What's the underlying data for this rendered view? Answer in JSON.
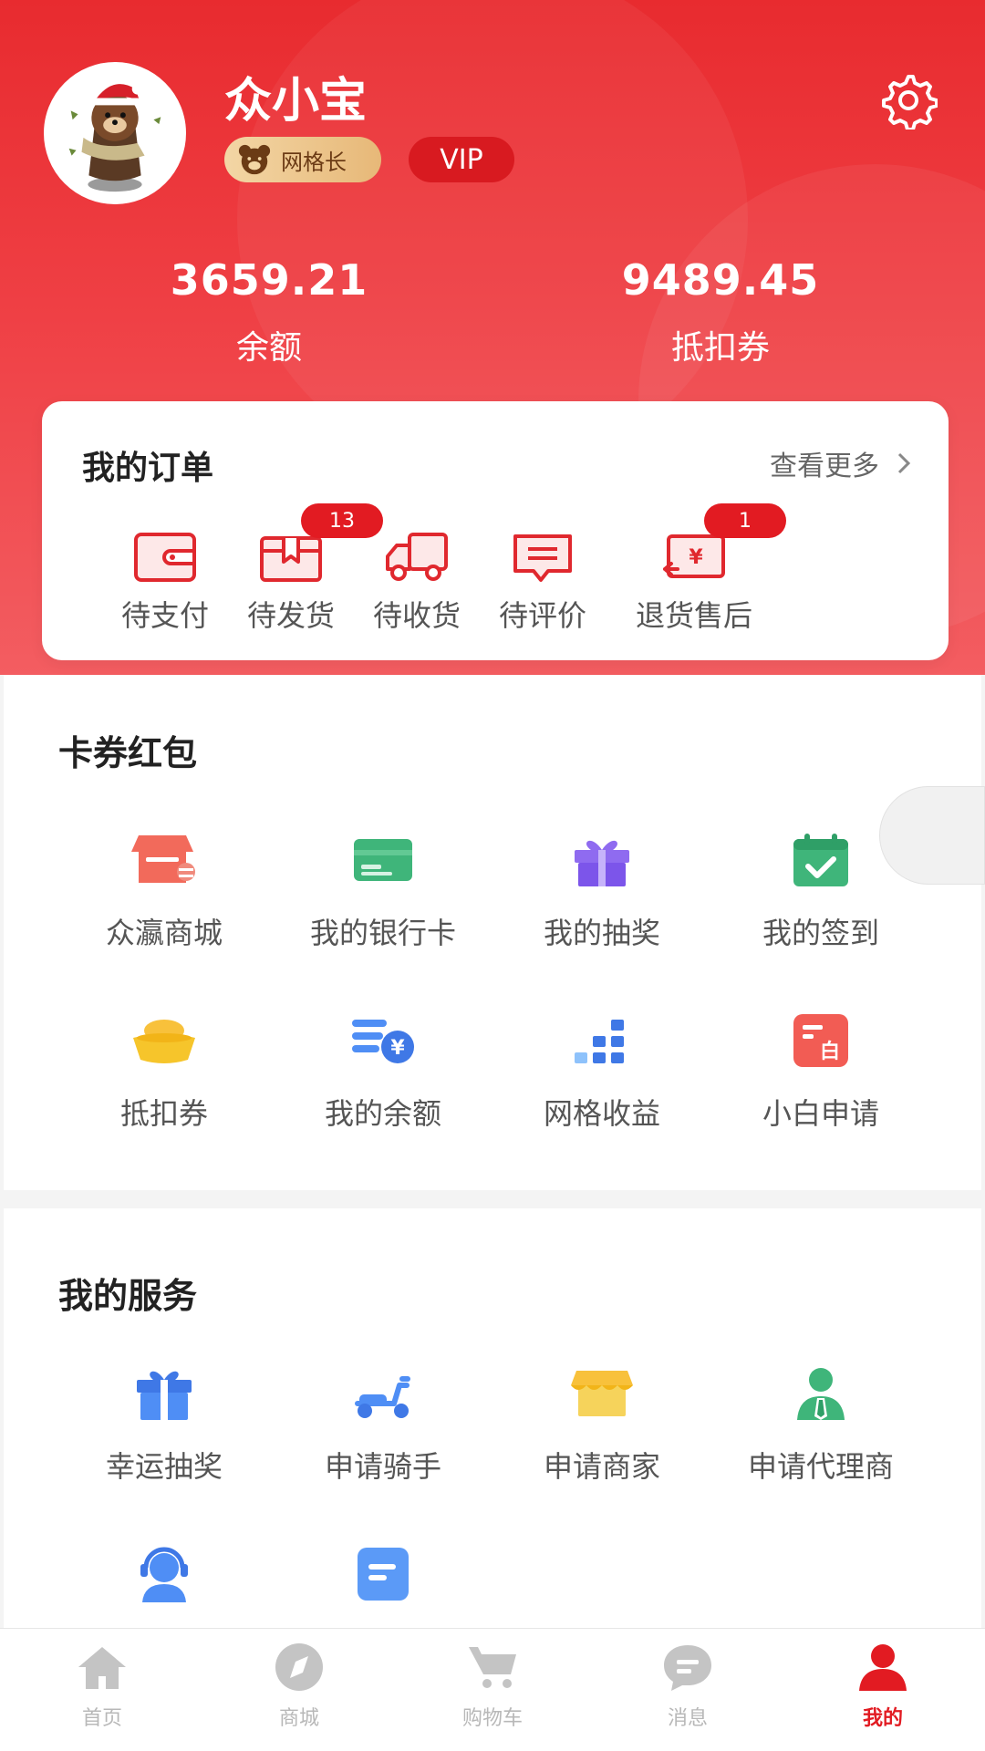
{
  "profile": {
    "name": "众小宝",
    "badge_label": "网格长",
    "vip_label": "VIP"
  },
  "stats": [
    {
      "value": "3659.21",
      "label": "余额"
    },
    {
      "value": "9489.45",
      "label": "抵扣券"
    }
  ],
  "orders": {
    "title": "我的订单",
    "more_label": "查看更多",
    "items": [
      {
        "label": "待支付",
        "icon": "wallet-icon"
      },
      {
        "label": "待发货",
        "icon": "package-icon",
        "count": "13"
      },
      {
        "label": "待收货",
        "icon": "truck-icon"
      },
      {
        "label": "待评价",
        "icon": "comment-icon"
      },
      {
        "label": "退货售后",
        "icon": "refund-icon",
        "count": "1"
      }
    ]
  },
  "coupons": {
    "title": "卡券红包",
    "items": [
      {
        "label": "众瀛商城",
        "icon": "store-icon"
      },
      {
        "label": "我的银行卡",
        "icon": "bank-card-icon"
      },
      {
        "label": "我的抽奖",
        "icon": "gift-icon"
      },
      {
        "label": "我的签到",
        "icon": "calendar-check-icon"
      },
      {
        "label": "抵扣券",
        "icon": "gold-ingot-icon"
      },
      {
        "label": "我的余额",
        "icon": "coins-icon"
      },
      {
        "label": "网格收益",
        "icon": "grid-bars-icon"
      },
      {
        "label": "小白申请",
        "icon": "application-icon"
      }
    ]
  },
  "services": {
    "title": "我的服务",
    "items": [
      {
        "label": "幸运抽奖",
        "icon": "gift-box-icon"
      },
      {
        "label": "申请骑手",
        "icon": "scooter-icon"
      },
      {
        "label": "申请商家",
        "icon": "shop-icon"
      },
      {
        "label": "申请代理商",
        "icon": "agent-icon"
      },
      {
        "label": "",
        "icon": "customer-service-icon"
      },
      {
        "label": "",
        "icon": "document-icon"
      }
    ]
  },
  "tabbar": {
    "items": [
      {
        "label": "首页",
        "icon": "home-icon"
      },
      {
        "label": "商城",
        "icon": "compass-icon"
      },
      {
        "label": "购物车",
        "icon": "cart-icon"
      },
      {
        "label": "消息",
        "icon": "message-icon"
      },
      {
        "label": "我的",
        "icon": "user-icon",
        "active": true
      }
    ]
  },
  "colors": {
    "brand_red": "#e21b22",
    "header_gradient_top": "#e82b2f",
    "badge_gold": "#e7b878"
  }
}
